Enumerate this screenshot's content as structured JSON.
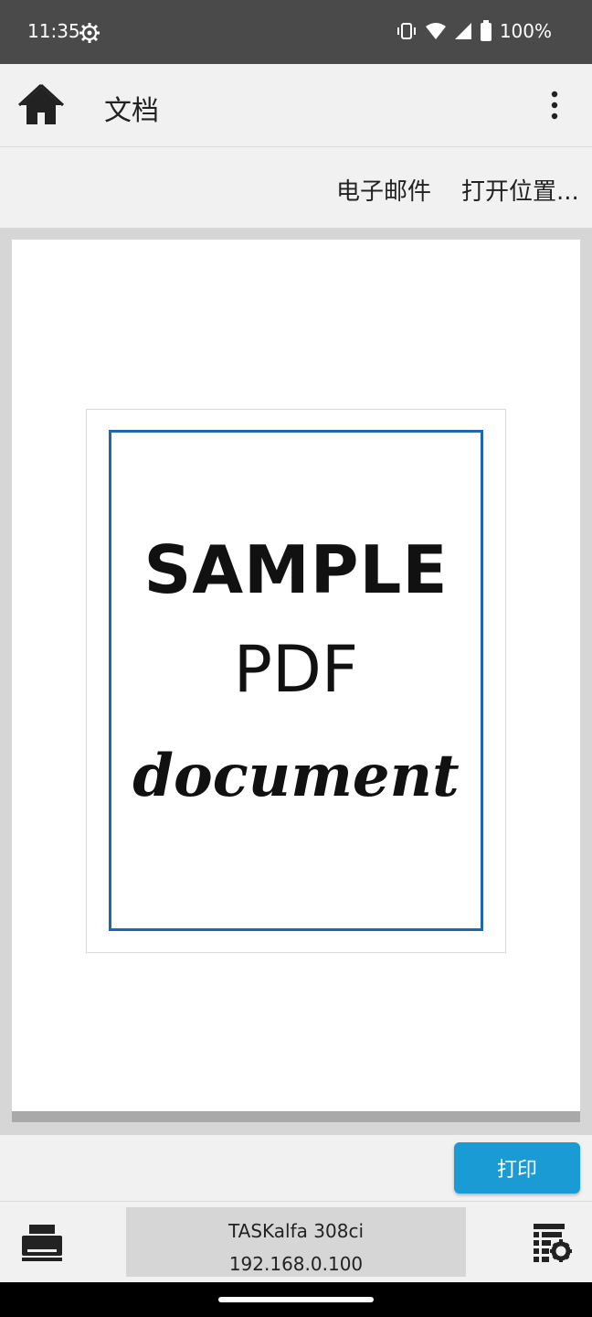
{
  "status_bar": {
    "time": "11:35",
    "battery": "100%"
  },
  "app_bar": {
    "title": "文档"
  },
  "actions": {
    "email": "电子邮件",
    "open_location": "打开位置..."
  },
  "document": {
    "line1": "SAMPLE",
    "line2": "PDF",
    "line3": "document",
    "frame_color": "#1f66b3"
  },
  "print_button": {
    "label": "打印",
    "color": "#1a9bd4"
  },
  "printer": {
    "name": "TASKalfa 308ci",
    "ip": "192.168.0.100"
  }
}
